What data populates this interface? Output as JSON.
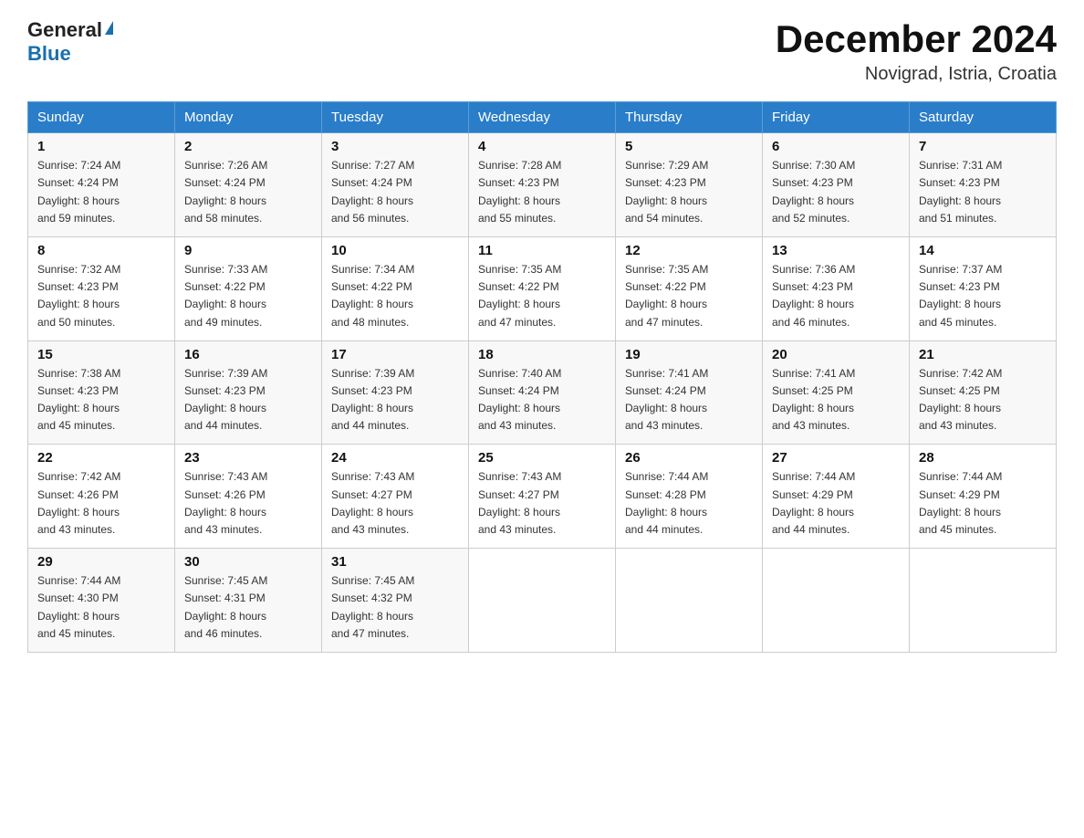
{
  "header": {
    "logo_general": "General",
    "logo_blue": "Blue",
    "title": "December 2024",
    "location": "Novigrad, Istria, Croatia"
  },
  "days_of_week": [
    "Sunday",
    "Monday",
    "Tuesday",
    "Wednesday",
    "Thursday",
    "Friday",
    "Saturday"
  ],
  "weeks": [
    [
      {
        "day": "1",
        "sunrise": "7:24 AM",
        "sunset": "4:24 PM",
        "daylight": "8 hours and 59 minutes."
      },
      {
        "day": "2",
        "sunrise": "7:26 AM",
        "sunset": "4:24 PM",
        "daylight": "8 hours and 58 minutes."
      },
      {
        "day": "3",
        "sunrise": "7:27 AM",
        "sunset": "4:24 PM",
        "daylight": "8 hours and 56 minutes."
      },
      {
        "day": "4",
        "sunrise": "7:28 AM",
        "sunset": "4:23 PM",
        "daylight": "8 hours and 55 minutes."
      },
      {
        "day": "5",
        "sunrise": "7:29 AM",
        "sunset": "4:23 PM",
        "daylight": "8 hours and 54 minutes."
      },
      {
        "day": "6",
        "sunrise": "7:30 AM",
        "sunset": "4:23 PM",
        "daylight": "8 hours and 52 minutes."
      },
      {
        "day": "7",
        "sunrise": "7:31 AM",
        "sunset": "4:23 PM",
        "daylight": "8 hours and 51 minutes."
      }
    ],
    [
      {
        "day": "8",
        "sunrise": "7:32 AM",
        "sunset": "4:23 PM",
        "daylight": "8 hours and 50 minutes."
      },
      {
        "day": "9",
        "sunrise": "7:33 AM",
        "sunset": "4:22 PM",
        "daylight": "8 hours and 49 minutes."
      },
      {
        "day": "10",
        "sunrise": "7:34 AM",
        "sunset": "4:22 PM",
        "daylight": "8 hours and 48 minutes."
      },
      {
        "day": "11",
        "sunrise": "7:35 AM",
        "sunset": "4:22 PM",
        "daylight": "8 hours and 47 minutes."
      },
      {
        "day": "12",
        "sunrise": "7:35 AM",
        "sunset": "4:22 PM",
        "daylight": "8 hours and 47 minutes."
      },
      {
        "day": "13",
        "sunrise": "7:36 AM",
        "sunset": "4:23 PM",
        "daylight": "8 hours and 46 minutes."
      },
      {
        "day": "14",
        "sunrise": "7:37 AM",
        "sunset": "4:23 PM",
        "daylight": "8 hours and 45 minutes."
      }
    ],
    [
      {
        "day": "15",
        "sunrise": "7:38 AM",
        "sunset": "4:23 PM",
        "daylight": "8 hours and 45 minutes."
      },
      {
        "day": "16",
        "sunrise": "7:39 AM",
        "sunset": "4:23 PM",
        "daylight": "8 hours and 44 minutes."
      },
      {
        "day": "17",
        "sunrise": "7:39 AM",
        "sunset": "4:23 PM",
        "daylight": "8 hours and 44 minutes."
      },
      {
        "day": "18",
        "sunrise": "7:40 AM",
        "sunset": "4:24 PM",
        "daylight": "8 hours and 43 minutes."
      },
      {
        "day": "19",
        "sunrise": "7:41 AM",
        "sunset": "4:24 PM",
        "daylight": "8 hours and 43 minutes."
      },
      {
        "day": "20",
        "sunrise": "7:41 AM",
        "sunset": "4:25 PM",
        "daylight": "8 hours and 43 minutes."
      },
      {
        "day": "21",
        "sunrise": "7:42 AM",
        "sunset": "4:25 PM",
        "daylight": "8 hours and 43 minutes."
      }
    ],
    [
      {
        "day": "22",
        "sunrise": "7:42 AM",
        "sunset": "4:26 PM",
        "daylight": "8 hours and 43 minutes."
      },
      {
        "day": "23",
        "sunrise": "7:43 AM",
        "sunset": "4:26 PM",
        "daylight": "8 hours and 43 minutes."
      },
      {
        "day": "24",
        "sunrise": "7:43 AM",
        "sunset": "4:27 PM",
        "daylight": "8 hours and 43 minutes."
      },
      {
        "day": "25",
        "sunrise": "7:43 AM",
        "sunset": "4:27 PM",
        "daylight": "8 hours and 43 minutes."
      },
      {
        "day": "26",
        "sunrise": "7:44 AM",
        "sunset": "4:28 PM",
        "daylight": "8 hours and 44 minutes."
      },
      {
        "day": "27",
        "sunrise": "7:44 AM",
        "sunset": "4:29 PM",
        "daylight": "8 hours and 44 minutes."
      },
      {
        "day": "28",
        "sunrise": "7:44 AM",
        "sunset": "4:29 PM",
        "daylight": "8 hours and 45 minutes."
      }
    ],
    [
      {
        "day": "29",
        "sunrise": "7:44 AM",
        "sunset": "4:30 PM",
        "daylight": "8 hours and 45 minutes."
      },
      {
        "day": "30",
        "sunrise": "7:45 AM",
        "sunset": "4:31 PM",
        "daylight": "8 hours and 46 minutes."
      },
      {
        "day": "31",
        "sunrise": "7:45 AM",
        "sunset": "4:32 PM",
        "daylight": "8 hours and 47 minutes."
      },
      null,
      null,
      null,
      null
    ]
  ],
  "labels": {
    "sunrise": "Sunrise:",
    "sunset": "Sunset:",
    "daylight": "Daylight:"
  }
}
